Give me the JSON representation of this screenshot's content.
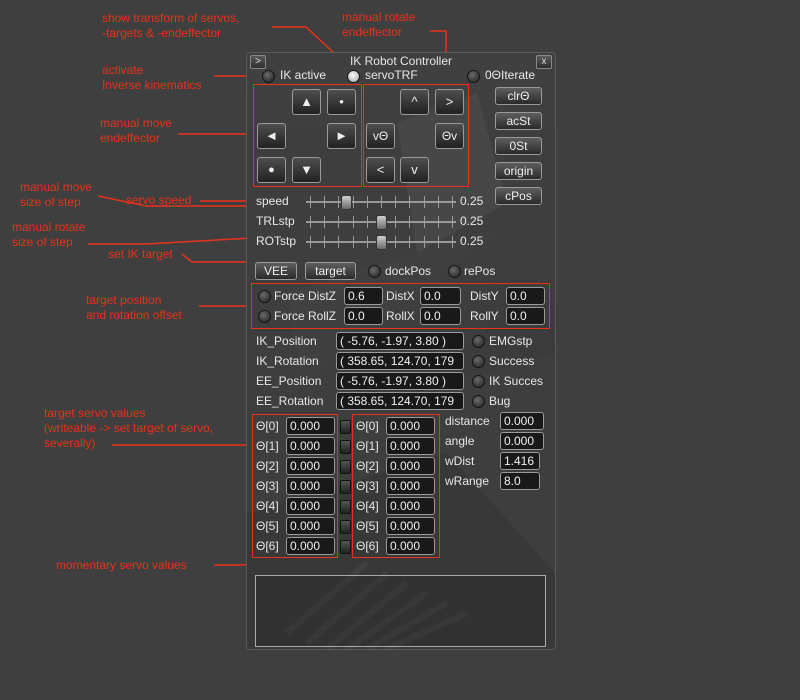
{
  "annotations": {
    "show_transform": [
      "show transform of servos,",
      "-targets & -endeffector"
    ],
    "manual_rotate_ee": [
      "manual rotate",
      "endeffector"
    ],
    "activate_ik": [
      "activate",
      "Inverse kinematics"
    ],
    "manual_move_ee": [
      "manual move",
      "endeffector"
    ],
    "manual_move_step": [
      "manual move",
      "size of step"
    ],
    "servo_speed": "servo speed",
    "manual_rotate_step": [
      "manual rotate",
      "size of step"
    ],
    "set_ik_target": "set IK target",
    "target_offset": [
      "target position",
      "and rotation offset"
    ],
    "target_servo_values": [
      "target servo values",
      "(writeable -> set target of servo,",
      "severally)"
    ],
    "momentary_servo_values": "momentary servo values"
  },
  "window": {
    "title": "IK Robot Controller",
    "left_button": ">",
    "close_button": "x"
  },
  "toggles": {
    "ik_active": {
      "label": "IK active",
      "on": false
    },
    "servo_trf": {
      "label": "servoTRF",
      "on": true
    },
    "zero_iterate": {
      "label": "0ΘIterate",
      "on": false
    }
  },
  "move_pad": {
    "up": "▲",
    "dot_small": "•",
    "left": "◄",
    "right": "►",
    "dot_big": "●",
    "down": "▼"
  },
  "rotate_pad": {
    "caret_up": "^",
    "gt": ">",
    "v_theta": "vΘ",
    "theta_v": "Θv",
    "lt": "<",
    "v": "v"
  },
  "right_buttons": [
    "clrΘ",
    "acSt",
    "0St",
    "origin",
    "cPos"
  ],
  "sliders": [
    {
      "label": "speed",
      "value": "0.25",
      "fraction": 0.25
    },
    {
      "label": "TRLstp",
      "value": "0.25",
      "fraction": 0.5
    },
    {
      "label": "ROTstp",
      "value": "0.25",
      "fraction": 0.5
    }
  ],
  "target_row": {
    "vee": "VEE",
    "target": "target",
    "dock_pos": "dockPos",
    "re_pos": "rePos"
  },
  "offsets": {
    "force_distz": {
      "label": "Force DistZ",
      "value": "0.6"
    },
    "distx": {
      "label": "DistX",
      "value": "0.0"
    },
    "disty": {
      "label": "DistY",
      "value": "0.0"
    },
    "force_rollz": {
      "label": "Force RollZ",
      "value": "0.0"
    },
    "rollx": {
      "label": "RollX",
      "value": "0.0"
    },
    "rolly": {
      "label": "RollY",
      "value": "0.0"
    }
  },
  "status": [
    {
      "label": "IK_Position",
      "value": "( -5.76, -1.97, 3.80 )",
      "flag": "EMGstp"
    },
    {
      "label": "IK_Rotation",
      "value": "( 358.65, 124.70, 179",
      "flag": "Success"
    },
    {
      "label": "EE_Position",
      "value": "( -5.76, -1.97, 3.80 )",
      "flag": "IK Succes"
    },
    {
      "label": "EE_Rotation",
      "value": "( 358.65, 124.70, 179",
      "flag": "Bug"
    }
  ],
  "target_servos": [
    {
      "label": "Θ[0]",
      "value": "0.000"
    },
    {
      "label": "Θ[1]",
      "value": "0.000"
    },
    {
      "label": "Θ[2]",
      "value": "0.000"
    },
    {
      "label": "Θ[3]",
      "value": "0.000"
    },
    {
      "label": "Θ[4]",
      "value": "0.000"
    },
    {
      "label": "Θ[5]",
      "value": "0.000"
    },
    {
      "label": "Θ[6]",
      "value": "0.000"
    }
  ],
  "momentary_servos": [
    {
      "label": "Θ[0]",
      "value": "0.000"
    },
    {
      "label": "Θ[1]",
      "value": "0.000"
    },
    {
      "label": "Θ[2]",
      "value": "0.000"
    },
    {
      "label": "Θ[3]",
      "value": "0.000"
    },
    {
      "label": "Θ[4]",
      "value": "0.000"
    },
    {
      "label": "Θ[5]",
      "value": "0.000"
    },
    {
      "label": "Θ[6]",
      "value": "0.000"
    }
  ],
  "metrics": [
    {
      "label": "distance",
      "value": "0.000"
    },
    {
      "label": "angle",
      "value": "0.000"
    },
    {
      "label": "wDist",
      "value": "1.416"
    },
    {
      "label": "wRange",
      "value": "8.0"
    }
  ],
  "colors": {
    "annotation": "#e8321a",
    "panel": "#404040",
    "field": "#191919"
  }
}
